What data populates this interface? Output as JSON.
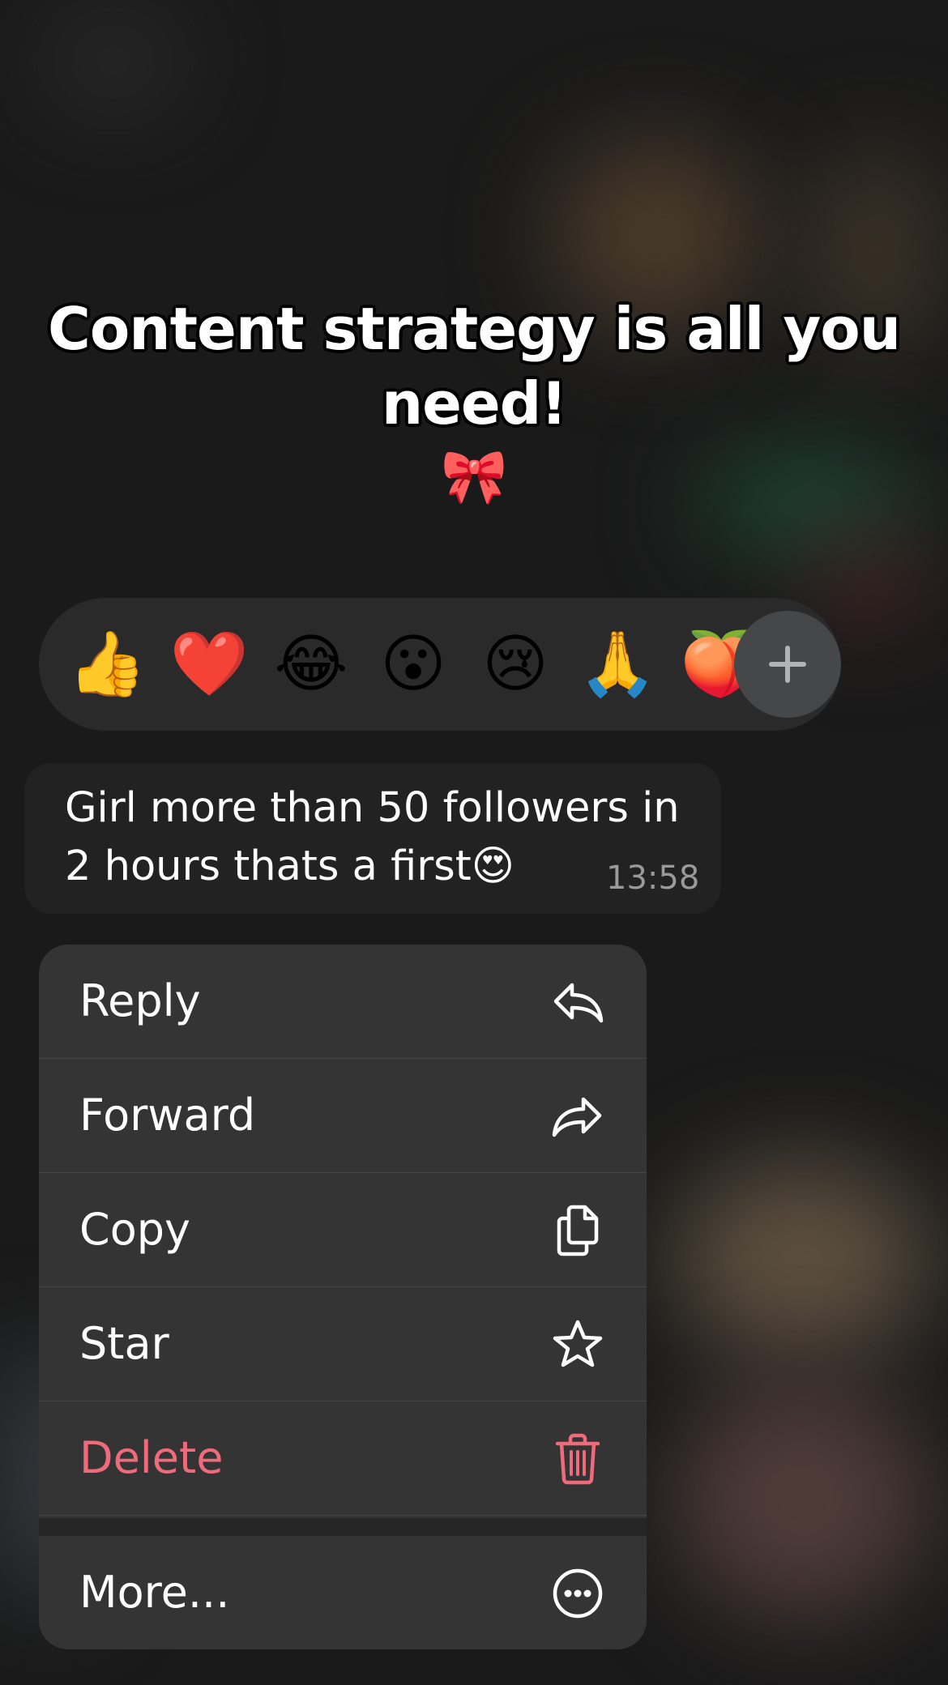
{
  "headline": {
    "line1": "Content strategy is all you",
    "line2": "need!",
    "emoji": "🎀"
  },
  "reactions": [
    {
      "emoji": "👍",
      "icon": "thumbs-up"
    },
    {
      "emoji": "❤️",
      "icon": "heart"
    },
    {
      "emoji": "😂",
      "icon": "tears-of-joy"
    },
    {
      "emoji": "😮",
      "icon": "surprised"
    },
    {
      "emoji": "😢",
      "icon": "crying"
    },
    {
      "emoji": "🙏",
      "icon": "folded-hands"
    },
    {
      "emoji": "🍑",
      "icon": "peach"
    }
  ],
  "message": {
    "line1": "Girl more than 50 followers in",
    "line2": "2 hours thats a first😍",
    "time": "13:58"
  },
  "menu": {
    "items": [
      {
        "label": "Reply",
        "icon": "reply-icon"
      },
      {
        "label": "Forward",
        "icon": "forward-icon"
      },
      {
        "label": "Copy",
        "icon": "copy-icon"
      },
      {
        "label": "Star",
        "icon": "star-icon"
      },
      {
        "label": "Delete",
        "icon": "trash-icon",
        "color": "#ef6b7b"
      },
      {
        "label": "More...",
        "icon": "more-icon"
      }
    ]
  }
}
